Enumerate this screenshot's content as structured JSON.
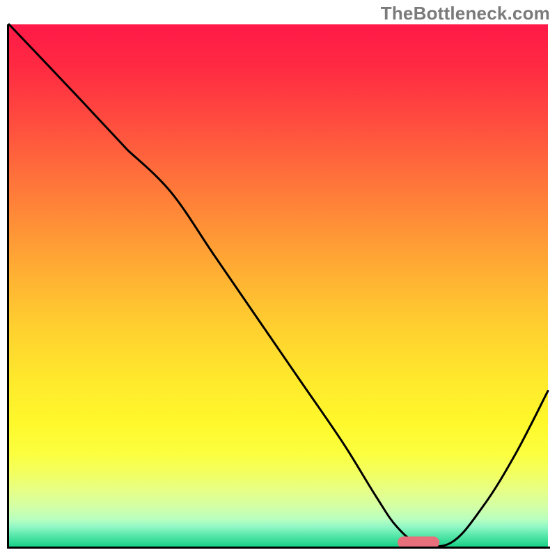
{
  "watermark": "TheBottleneck.com",
  "chart_data": {
    "type": "line",
    "title": "",
    "xlabel": "",
    "ylabel": "",
    "xlim": [
      0,
      100
    ],
    "ylim": [
      0,
      100
    ],
    "x": [
      0,
      12,
      22,
      30,
      38,
      46,
      54,
      62,
      68,
      72,
      76,
      82,
      88,
      94,
      100
    ],
    "values": [
      100,
      87,
      76,
      68,
      56,
      44,
      32,
      20,
      10,
      4,
      1,
      1,
      8,
      18,
      30
    ],
    "gradient_note": "background encodes bottleneck severity: red (top) = high bottleneck, green (bottom) = optimal",
    "marker": {
      "x": 76,
      "y": 1
    },
    "curve_kink_at_x": 22
  },
  "colors": {
    "axis": "#000000",
    "curve": "#000000",
    "marker": "#e8707c",
    "watermark": "#7a7a7a"
  }
}
